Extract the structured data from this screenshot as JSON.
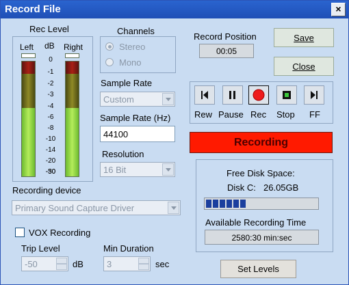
{
  "window": {
    "title": "Record File",
    "close_glyph": "×"
  },
  "rec_level": {
    "title": "Rec Level",
    "left_label": "Left",
    "db_label": "dB",
    "right_label": "Right",
    "scale": [
      "0",
      "-1",
      "-2",
      "-3",
      "-4",
      "-6",
      "-8",
      "-10",
      "-14",
      "-20",
      "-30",
      "-50"
    ]
  },
  "channels": {
    "title": "Channels",
    "stereo": "Stereo",
    "mono": "Mono",
    "selected": "Stereo"
  },
  "sample_rate": {
    "label": "Sample Rate",
    "value": "Custom"
  },
  "sample_rate_hz": {
    "label": "Sample Rate (Hz)",
    "value": "44100"
  },
  "resolution": {
    "label": "Resolution",
    "value": "16 Bit"
  },
  "recording_device": {
    "label": "Recording device",
    "value": "Primary Sound Capture Driver"
  },
  "vox": {
    "label": "VOX Recording",
    "checked": false
  },
  "trip_level": {
    "label": "Trip Level",
    "value": "-50",
    "unit": "dB"
  },
  "min_duration": {
    "label": "Min Duration",
    "value": "3",
    "unit": "sec"
  },
  "record_position": {
    "label": "Record Position",
    "value": "00:05"
  },
  "buttons": {
    "save": "Save",
    "close": "Close",
    "set_levels": "Set Levels"
  },
  "transport": {
    "rew": "Rew",
    "pause": "Pause",
    "rec": "Rec",
    "stop": "Stop",
    "ff": "FF"
  },
  "status": {
    "text": "Recording",
    "color": "#ff1a00"
  },
  "disk": {
    "title": "Free Disk Space:",
    "disk_label": "Disk C:",
    "free": "26.05GB",
    "used_fraction": 0.4,
    "available_label": "Available Recording Time",
    "available_value": "2580:30 min:sec"
  }
}
